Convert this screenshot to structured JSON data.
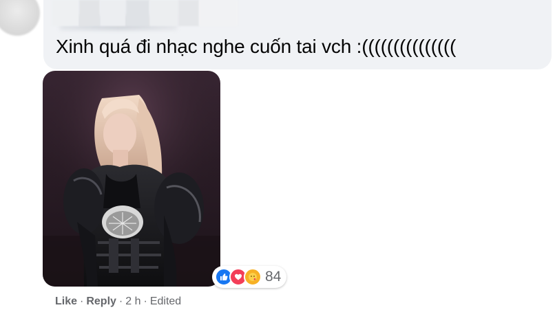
{
  "comment": {
    "author_blurred": true,
    "text": "Xinh quá đi nhạc nghe cuốn tai vch :(((((((((((((((",
    "image_alt": "Photo of a woman with blonde hair in a black outfit"
  },
  "reactions": {
    "icons": [
      "like-icon",
      "love-icon",
      "care-icon"
    ],
    "count": "84"
  },
  "actions": {
    "like": "Like",
    "reply": "Reply",
    "separator": "·",
    "time": "2 h",
    "edited": "Edited"
  },
  "colors": {
    "bubble": "#f0f2f5",
    "text": "#050505",
    "meta": "#65676b",
    "like": "#1877f2",
    "love": "#f33e58",
    "care": "#f7b125"
  }
}
